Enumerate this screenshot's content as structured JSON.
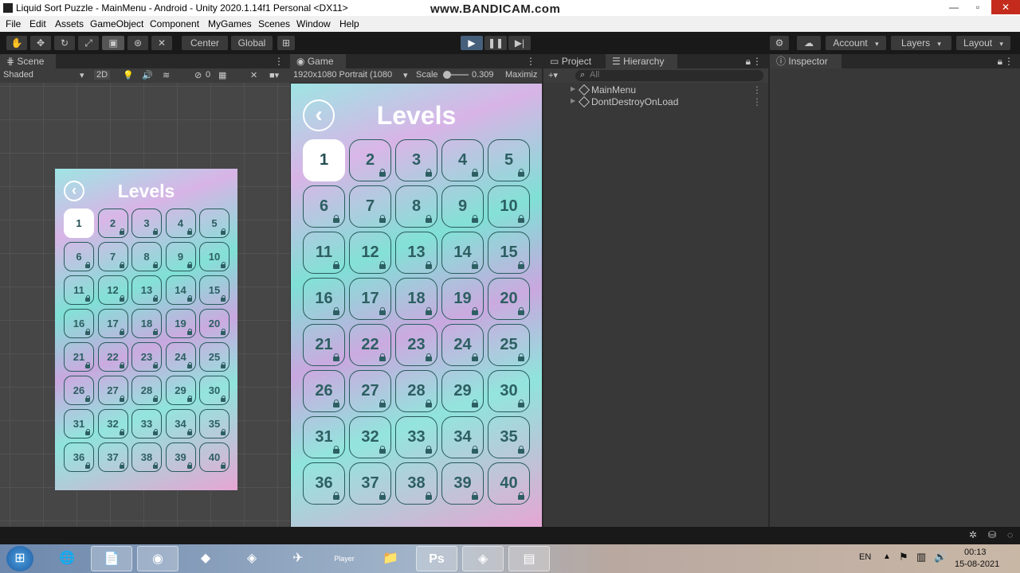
{
  "window": {
    "title": "Liquid Sort Puzzle - MainMenu - Android - Unity 2020.1.14f1 Personal <DX11>",
    "watermark": "www.BANDICAM.com"
  },
  "menu": [
    "File",
    "Edit",
    "Assets",
    "GameObject",
    "Component",
    "MyGames",
    "Scenes",
    "Window",
    "Help"
  ],
  "toolbar": {
    "pivot": "Center",
    "space": "Global",
    "account": "Account",
    "layers": "Layers",
    "layout": "Layout"
  },
  "scene": {
    "tab": "Scene",
    "shading": "Shaded",
    "mode_2d": "2D",
    "gizmo_count": "0"
  },
  "game": {
    "tab": "Game",
    "resolution": "1920x1080 Portrait (1080",
    "scale_label": "Scale",
    "scale_value": "0.309",
    "maximize": "Maximiz"
  },
  "project": {
    "tab": "Project"
  },
  "hierarchy": {
    "tab": "Hierarchy",
    "search_placeholder": "All",
    "items": [
      "MainMenu",
      "DontDestroyOnLoad"
    ]
  },
  "inspector": {
    "tab": "Inspector"
  },
  "levels_ui": {
    "title": "Levels",
    "back_glyph": "‹",
    "levels": [
      "1",
      "2",
      "3",
      "4",
      "5",
      "6",
      "7",
      "8",
      "9",
      "10",
      "11",
      "12",
      "13",
      "14",
      "15",
      "16",
      "17",
      "18",
      "19",
      "20",
      "21",
      "22",
      "23",
      "24",
      "25",
      "26",
      "27",
      "28",
      "29",
      "30",
      "31",
      "32",
      "33",
      "34",
      "35",
      "36",
      "37",
      "38",
      "39",
      "40"
    ],
    "unlocked_count": 1
  },
  "tray": {
    "language": "EN",
    "time": "00:13",
    "date": "15-08-2021"
  },
  "taskbar": {
    "player_label": "Player"
  },
  "colors": {
    "unity_dark": "#383838",
    "play_active": "#46607c",
    "level_text": "#2d5f62"
  }
}
